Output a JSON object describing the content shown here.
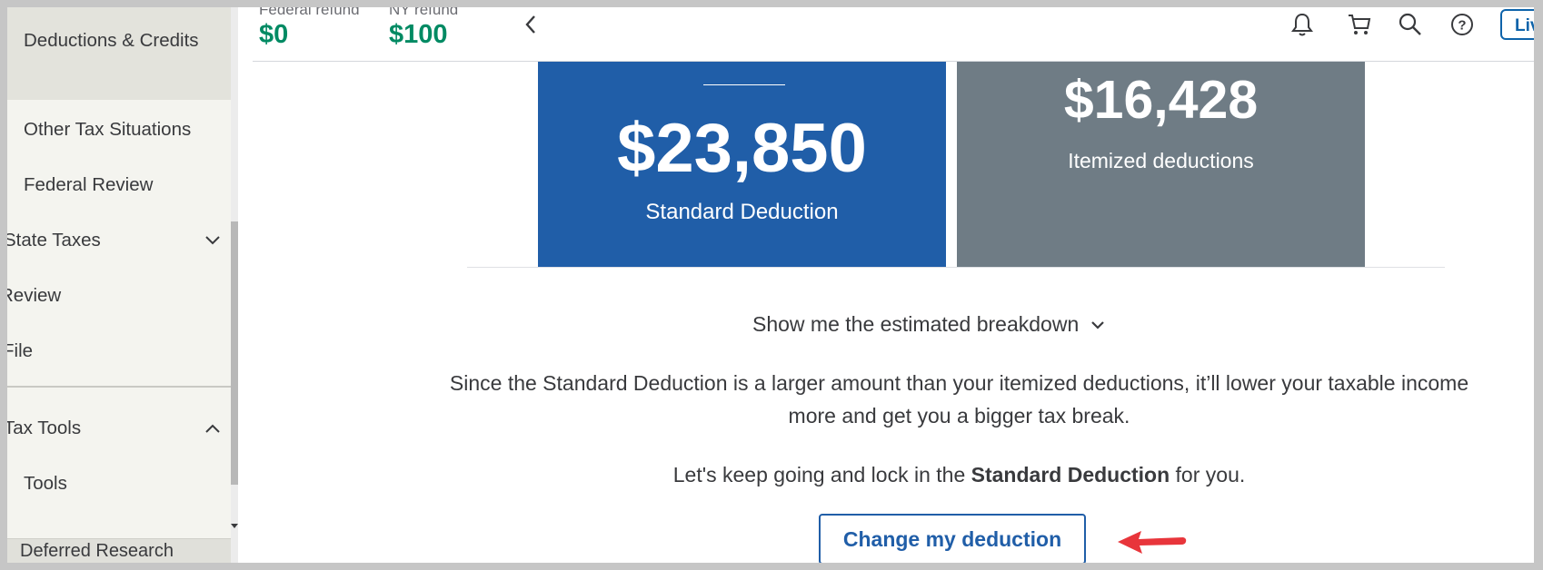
{
  "sidebar": {
    "items": [
      {
        "label": "Deductions & Credits",
        "active": true
      },
      {
        "label": "Other Tax Situations"
      },
      {
        "label": "Federal Review"
      },
      {
        "label": "State Taxes",
        "chevron": "chevron-down-icon"
      },
      {
        "label": "Review"
      },
      {
        "label": "File"
      },
      {
        "label": "Tax Tools",
        "chevron": "chevron-up-icon"
      },
      {
        "label": "Tools"
      }
    ],
    "bottom_partial": "Deferred Research"
  },
  "header": {
    "federal_refund_label": "Federal refund",
    "federal_refund_value": "$0",
    "state_refund_label": "NY refund",
    "state_refund_value": "$100",
    "live_label": "Live",
    "icons": [
      "back-chevron-icon",
      "bell-icon",
      "cart-icon",
      "search-icon",
      "help-icon"
    ]
  },
  "cards": {
    "standard_amount": "$23,850",
    "standard_label": "Standard Deduction",
    "itemized_amount": "$16,428",
    "itemized_label": "Itemized deductions"
  },
  "main": {
    "breakdown_label": "Show me the estimated breakdown",
    "paragraph_line1": "Since the Standard Deduction is a larger amount than your itemized deductions, it’ll lower your taxable income",
    "paragraph_line2": "more and get you a bigger tax break.",
    "lockin_prefix": "Let's keep going and lock in the ",
    "lockin_bold": "Standard Deduction",
    "lockin_suffix": " for you.",
    "change_button": "Change my deduction"
  },
  "colors": {
    "primary_blue": "#205ea8",
    "card_grey": "#6f7c85",
    "refund_green": "#008a63",
    "annotation_arrow": "#e8353b"
  }
}
